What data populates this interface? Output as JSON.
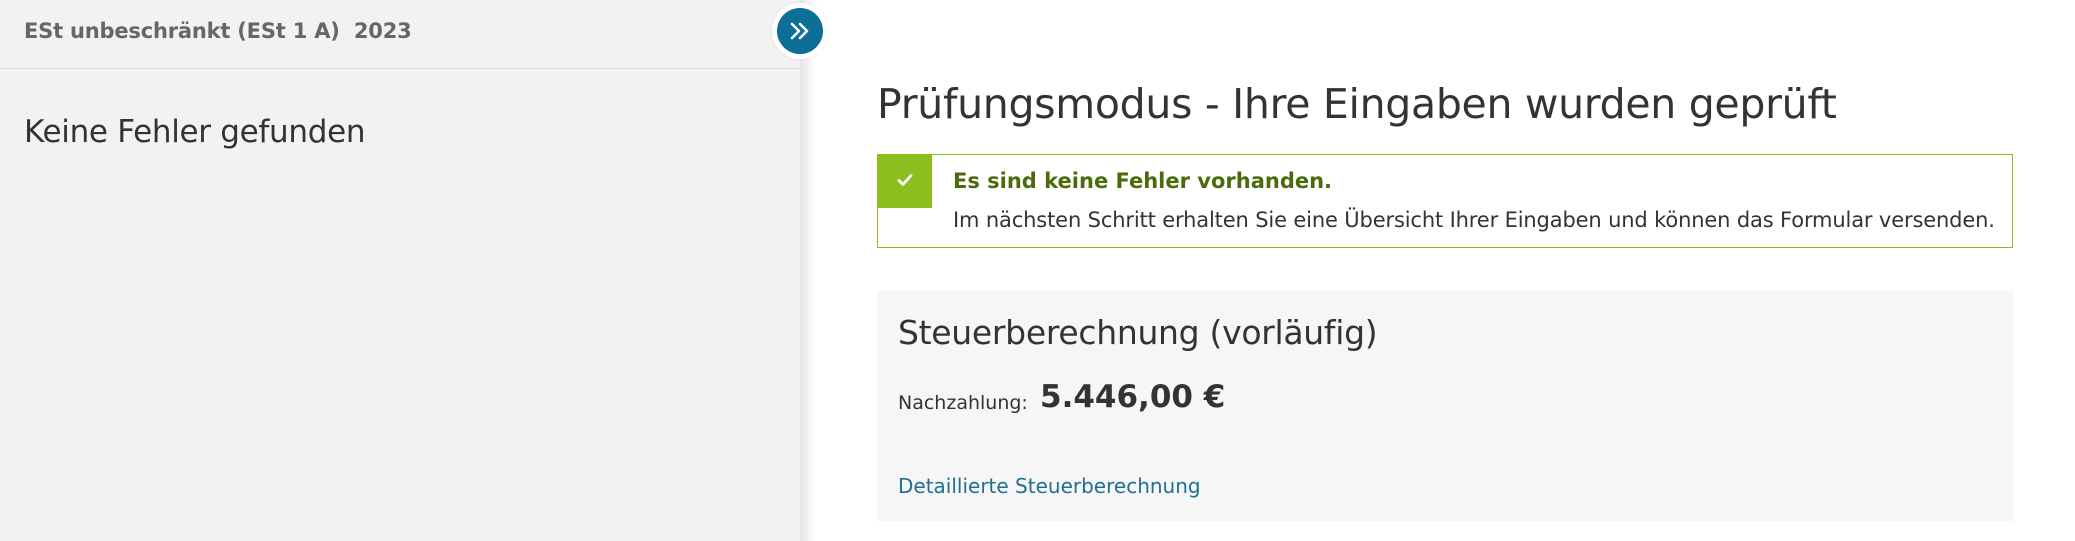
{
  "sidebar": {
    "title": "ESt unbeschränkt (ESt 1 A)  2023",
    "message": "Keine Fehler gefunden",
    "toggle_icon": "double-chevron-right-icon"
  },
  "main": {
    "title": "Prüfungsmodus - Ihre Eingaben wurden geprüft",
    "success": {
      "icon": "check-icon",
      "heading": "Es sind keine Fehler vorhanden.",
      "text": "Im nächsten Schritt erhalten Sie eine Übersicht Ihrer Eingaben und können das Formular versenden."
    },
    "tax": {
      "title": "Steuerberechnung (vorläufig)",
      "label": "Nachzahlung:",
      "value": "5.446,00 €",
      "link": "Detaillierte Steuerberechnung"
    }
  },
  "colors": {
    "accent_blue": "#0b6f98",
    "success_green": "#8cbe1e",
    "success_text": "#4a6b0c",
    "link": "#1f6f92"
  }
}
